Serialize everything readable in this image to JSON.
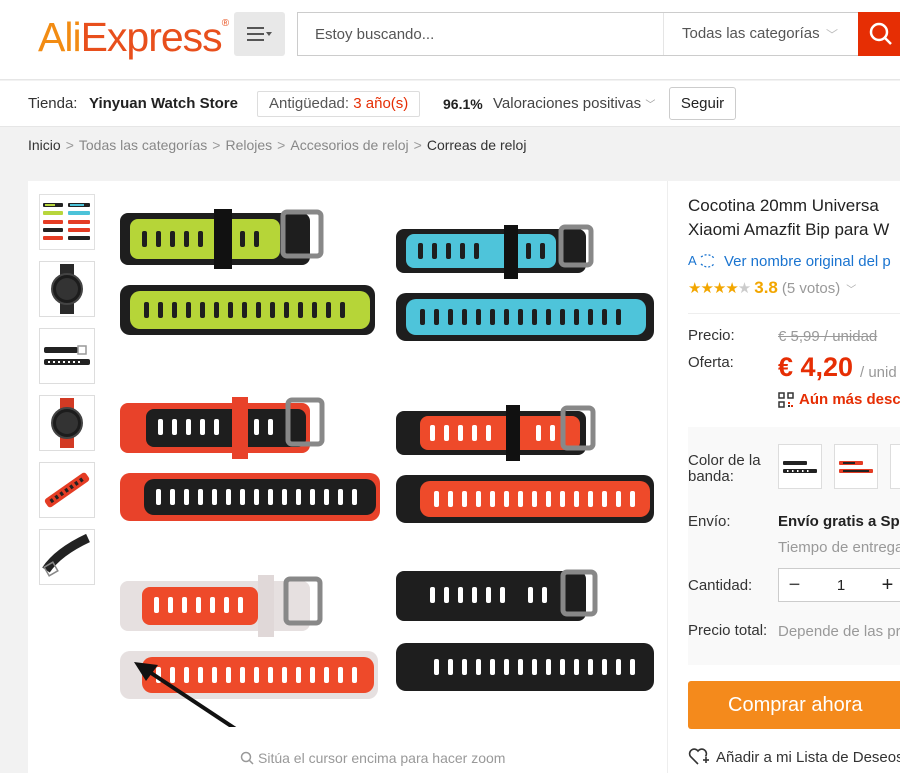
{
  "header": {
    "logo_ali": "Ali",
    "logo_express": "Express",
    "search_placeholder": "Estoy buscando...",
    "category_select": "Todas las categorías"
  },
  "store": {
    "label": "Tienda:",
    "name": "Yinyuan Watch Store",
    "age_label": "Antigüedad: ",
    "age_value": "3 año(s)",
    "rating_pct": "96.1%",
    "rating_text": "Valoraciones positivas",
    "follow": "Seguir"
  },
  "breadcrumb": [
    "Inicio",
    "Todas las categorías",
    "Relojes",
    "Accesorios de reloj",
    "Correas de reloj"
  ],
  "gallery": {
    "zoom_hint": "Sitúa el cursor encima para hacer zoom"
  },
  "product": {
    "title_line1": "Cocotina 20mm Universa",
    "title_line2": "Xiaomi Amazfit Bip para W",
    "translate_link": "Ver nombre original del p",
    "rating_score": "3.8",
    "votes": "(5 votos)",
    "price_label": "Precio:",
    "price_old": "€ 5,99 / unidad",
    "offer_label": "Oferta:",
    "price_new": "€ 4,20",
    "price_unit": "/ unid",
    "discount": "Aún más descu",
    "color_label": "Color de la banda:",
    "shipping_label": "Envío:",
    "shipping_value": "Envío gratis a Sp",
    "shipping_time": "Tiempo de entrega",
    "qty_label": "Cantidad:",
    "qty_value": "1",
    "total_label": "Precio total:",
    "total_value": "Depende de las pr",
    "buy_now": "Comprar ahora",
    "wishlist": "Añadir a mi Lista de Deseos"
  },
  "colors": {
    "accent": "#e62e04",
    "orange": "#f48a1c",
    "star": "#f2a600",
    "link": "#1a74d0"
  },
  "icons": [
    "menu-icon",
    "search-icon",
    "translate-icon",
    "qr-icon",
    "zoom-icon",
    "heart-plus-icon"
  ]
}
